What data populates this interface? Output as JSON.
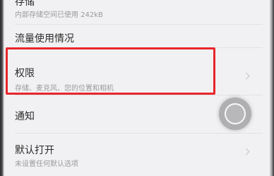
{
  "settings": {
    "storage": {
      "title": "存储",
      "subtitle": "内部存储空间已使用 242kB"
    },
    "data_usage": {
      "title": "流量使用情况"
    },
    "permissions": {
      "title": "权限",
      "subtitle": "存储、麦克风、您的位置和相机"
    },
    "notifications": {
      "title": "通知"
    },
    "open_by_default": {
      "title": "默认打开",
      "subtitle": "未设置任何默认选项"
    }
  },
  "annotation": {
    "highlight_color": "#e8262b"
  },
  "icons": {
    "chevron": "chevron-right-icon",
    "floating": "assistive-touch-icon"
  }
}
